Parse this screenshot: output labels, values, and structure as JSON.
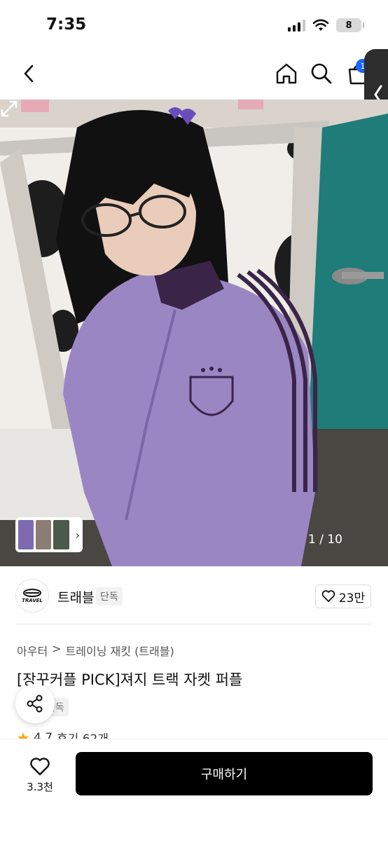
{
  "status_bar": {
    "time": "7:35",
    "battery": "8"
  },
  "nav": {
    "cart_badge": "1"
  },
  "hero": {
    "counter": "1 / 10"
  },
  "seller": {
    "logo_text": "TRAVEL",
    "name": "트래블",
    "tag": "단독",
    "likes": "23만"
  },
  "product": {
    "breadcrumb": [
      "아우터",
      ">",
      "트레이닝 재킷 (트래블)"
    ],
    "title": "[장꾸커플 PICK]져지 트랙 자켓 퍼플",
    "exclusive_tag": "단독",
    "rating": "4.7",
    "reviews": "후기 62개"
  },
  "bottom_bar": {
    "wish_count": "3.3천",
    "buy_label": "구매하기"
  },
  "colors": {
    "accent": "#1a64ff",
    "jacket": "#9b86c4",
    "stripe": "#3a2548",
    "buy_button": "#000000"
  },
  "icons": [
    "back-icon",
    "home-icon",
    "search-icon",
    "bag-icon",
    "expand-icon",
    "heart-icon",
    "share-icon",
    "star-icon"
  ]
}
